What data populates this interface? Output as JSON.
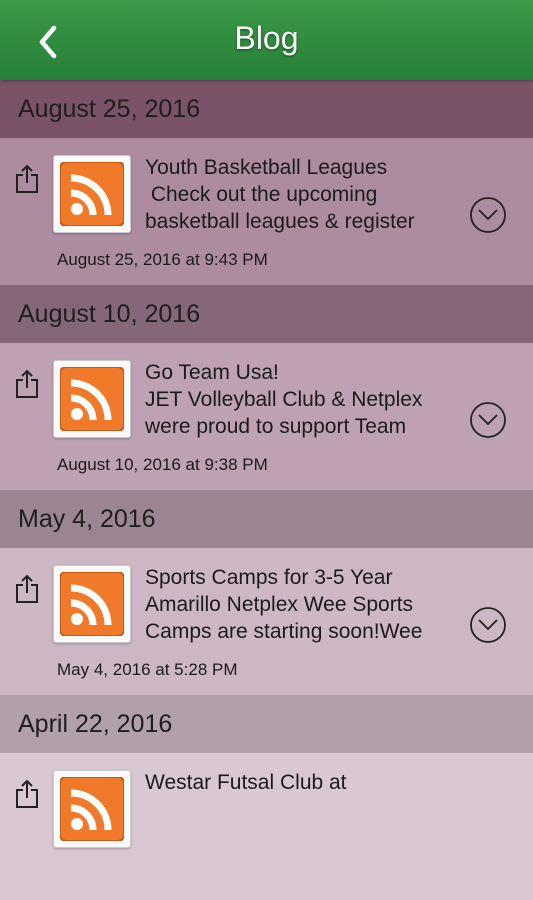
{
  "header": {
    "title": "Blog",
    "back_icon": "chevron-left-icon"
  },
  "colors": {
    "header_bg": "#2e8a3c",
    "section1_header": "#7a5368",
    "section1_item": "#ae8ca0",
    "section2_header": "#85677a",
    "section2_item": "#bea1b2",
    "section3_header": "#9c8592",
    "section3_item": "#cdb7c4",
    "section4_header": "#b19fa9",
    "section4_item": "#d9c8d2"
  },
  "sections": [
    {
      "date": "August 25, 2016",
      "item": {
        "title": "Youth Basketball Leagues",
        "line2": " Check out the upcoming",
        "line3": "basketball leagues & register",
        "timestamp": "August 25, 2016 at 9:43 PM"
      }
    },
    {
      "date": "August 10, 2016",
      "item": {
        "title": "Go Team Usa!",
        "line2": "JET Volleyball Club & Netplex",
        "line3": "were proud to support Team",
        "timestamp": "August 10, 2016 at 9:38 PM"
      }
    },
    {
      "date": "May 4, 2016",
      "item": {
        "title": "Sports Camps for 3-5 Year",
        "line2": "Amarillo Netplex Wee Sports",
        "line3": "Camps are starting soon!Wee",
        "timestamp": "May 4, 2016 at 5:28 PM"
      }
    },
    {
      "date": "April 22, 2016",
      "item": {
        "title": "Westar Futsal Club at",
        "line2": "",
        "line3": "",
        "timestamp": ""
      }
    }
  ],
  "icons": {
    "share": "share-icon",
    "thumbnail": "rss-feed-icon",
    "expand": "chevron-down-circle-icon"
  }
}
